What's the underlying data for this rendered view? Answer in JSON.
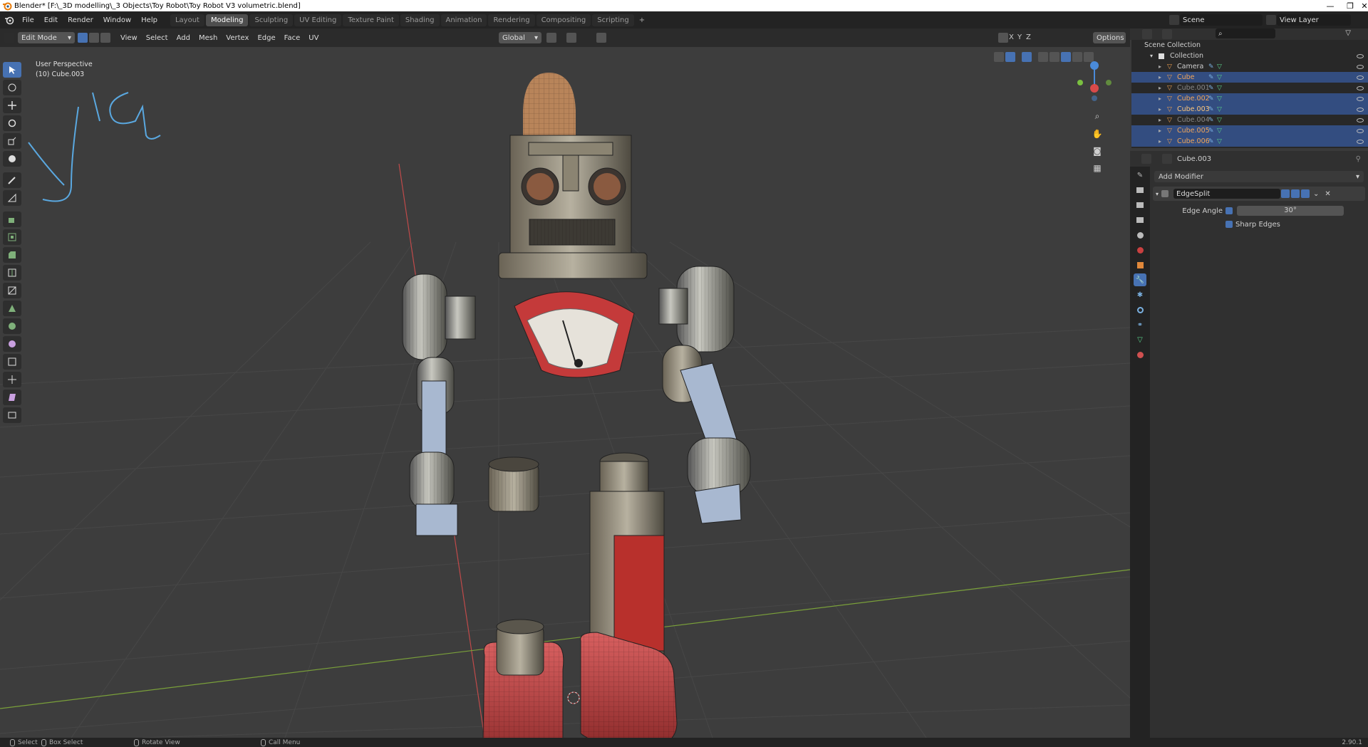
{
  "title": "Blender* [F:\\_3D modelling\\_3 Objects\\Toy Robot\\Toy Robot V3 volumetric.blend]",
  "window_controls": {
    "minimize": "—",
    "maximize": "❐",
    "close": "✕"
  },
  "menu": [
    "File",
    "Edit",
    "Render",
    "Window",
    "Help"
  ],
  "workspaces": [
    "Layout",
    "Modeling",
    "Sculpting",
    "UV Editing",
    "Texture Paint",
    "Shading",
    "Animation",
    "Rendering",
    "Compositing",
    "Scripting"
  ],
  "workspace_add": "+",
  "active_workspace": "Modeling",
  "scene": {
    "name": "Scene",
    "view_layer": "View Layer"
  },
  "viewport": {
    "mode": "Edit Mode",
    "menus": [
      "View",
      "Select",
      "Add",
      "Mesh",
      "Vertex",
      "Edge",
      "Face",
      "UV"
    ],
    "transform_orientation": "Global",
    "axis_toggles": [
      "X",
      "Y",
      "Z"
    ],
    "options_label": "Options",
    "info_line1": "User Perspective",
    "info_line2": "(10) Cube.003",
    "colors": {
      "grid_bg": "#3d3d3d",
      "x_axis": "#c04a4a",
      "y_axis": "#7aa03a"
    }
  },
  "outliner": {
    "scene_collection": "Scene Collection",
    "collection": "Collection",
    "items": [
      {
        "name": "Camera",
        "selected": false,
        "color": "#cfcfcf"
      },
      {
        "name": "Cube",
        "selected": true,
        "color": "#f2a65a"
      },
      {
        "name": "Cube.001",
        "selected": false,
        "color": "#888888"
      },
      {
        "name": "Cube.002",
        "selected": true,
        "color": "#f2a65a"
      },
      {
        "name": "Cube.003",
        "selected": true,
        "color": "#ffc77a"
      },
      {
        "name": "Cube.004",
        "selected": false,
        "color": "#888888"
      },
      {
        "name": "Cube.005",
        "selected": true,
        "color": "#f2a65a"
      },
      {
        "name": "Cube.006",
        "selected": true,
        "color": "#f2a65a"
      }
    ]
  },
  "properties": {
    "object_name": "Cube.003",
    "add_modifier": "Add Modifier",
    "modifier_name": "EdgeSplit",
    "edge_angle_label": "Edge Angle",
    "edge_angle_value": "30°",
    "sharp_edges_label": "Sharp Edges"
  },
  "statusbar": {
    "select": "Select",
    "box_select": "Box Select",
    "rotate_view": "Rotate View",
    "call_menu": "Call Menu",
    "version": "2.90.1"
  }
}
